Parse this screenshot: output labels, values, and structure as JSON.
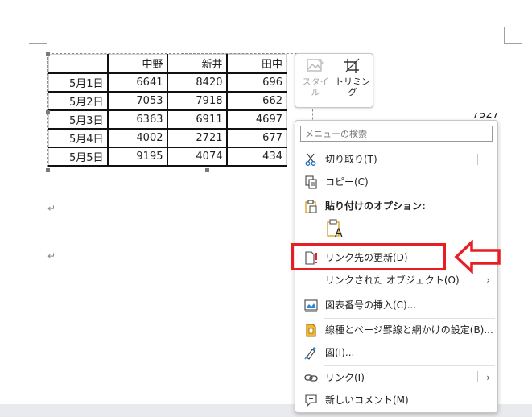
{
  "table": {
    "headers": [
      "",
      "中野",
      "新井",
      "田中"
    ],
    "rows": [
      {
        "date": "5月1日",
        "values": [
          "6641",
          "8420",
          "696"
        ]
      },
      {
        "date": "5月2日",
        "values": [
          "7053",
          "7918",
          "662"
        ]
      },
      {
        "date": "5月3日",
        "values": [
          "6363",
          "6911",
          "4697"
        ]
      },
      {
        "date": "5月4日",
        "values": [
          "4002",
          "2721",
          "677"
        ]
      },
      {
        "date": "5月5日",
        "values": [
          "9195",
          "4074",
          "434"
        ]
      }
    ],
    "overflow_value": "7527"
  },
  "mini_toolbar": {
    "style_label": "スタイル",
    "style_label_2": "ル",
    "style_label_1": "スタイ",
    "trim_label": "トリミング"
  },
  "context_menu": {
    "search_placeholder": "メニューの検索",
    "items": [
      {
        "label": "切り取り(T)",
        "icon": "scissors-icon"
      },
      {
        "label": "コピー(C)",
        "icon": "copy-icon"
      },
      {
        "label": "貼り付けのオプション:",
        "icon": "clipboard-icon"
      },
      {
        "label": "リンク先の更新(D)",
        "icon": "update-link-icon"
      },
      {
        "label": "リンクされた オブジェクト(O)",
        "icon": ""
      },
      {
        "label": "図表番号の挿入(C)...",
        "icon": "caption-icon"
      },
      {
        "label": "線種とページ罫線と網かけの設定(B)...",
        "icon": "borders-icon"
      },
      {
        "label": "図(I)...",
        "icon": "picture-format-icon"
      },
      {
        "label": "リンク(I)",
        "icon": "link-icon"
      },
      {
        "label": "新しいコメント(M)",
        "icon": "comment-icon"
      }
    ],
    "paste_option_letter": "A"
  },
  "colors": {
    "highlight": "#e81e25",
    "clipboard": "#d99a1c"
  }
}
